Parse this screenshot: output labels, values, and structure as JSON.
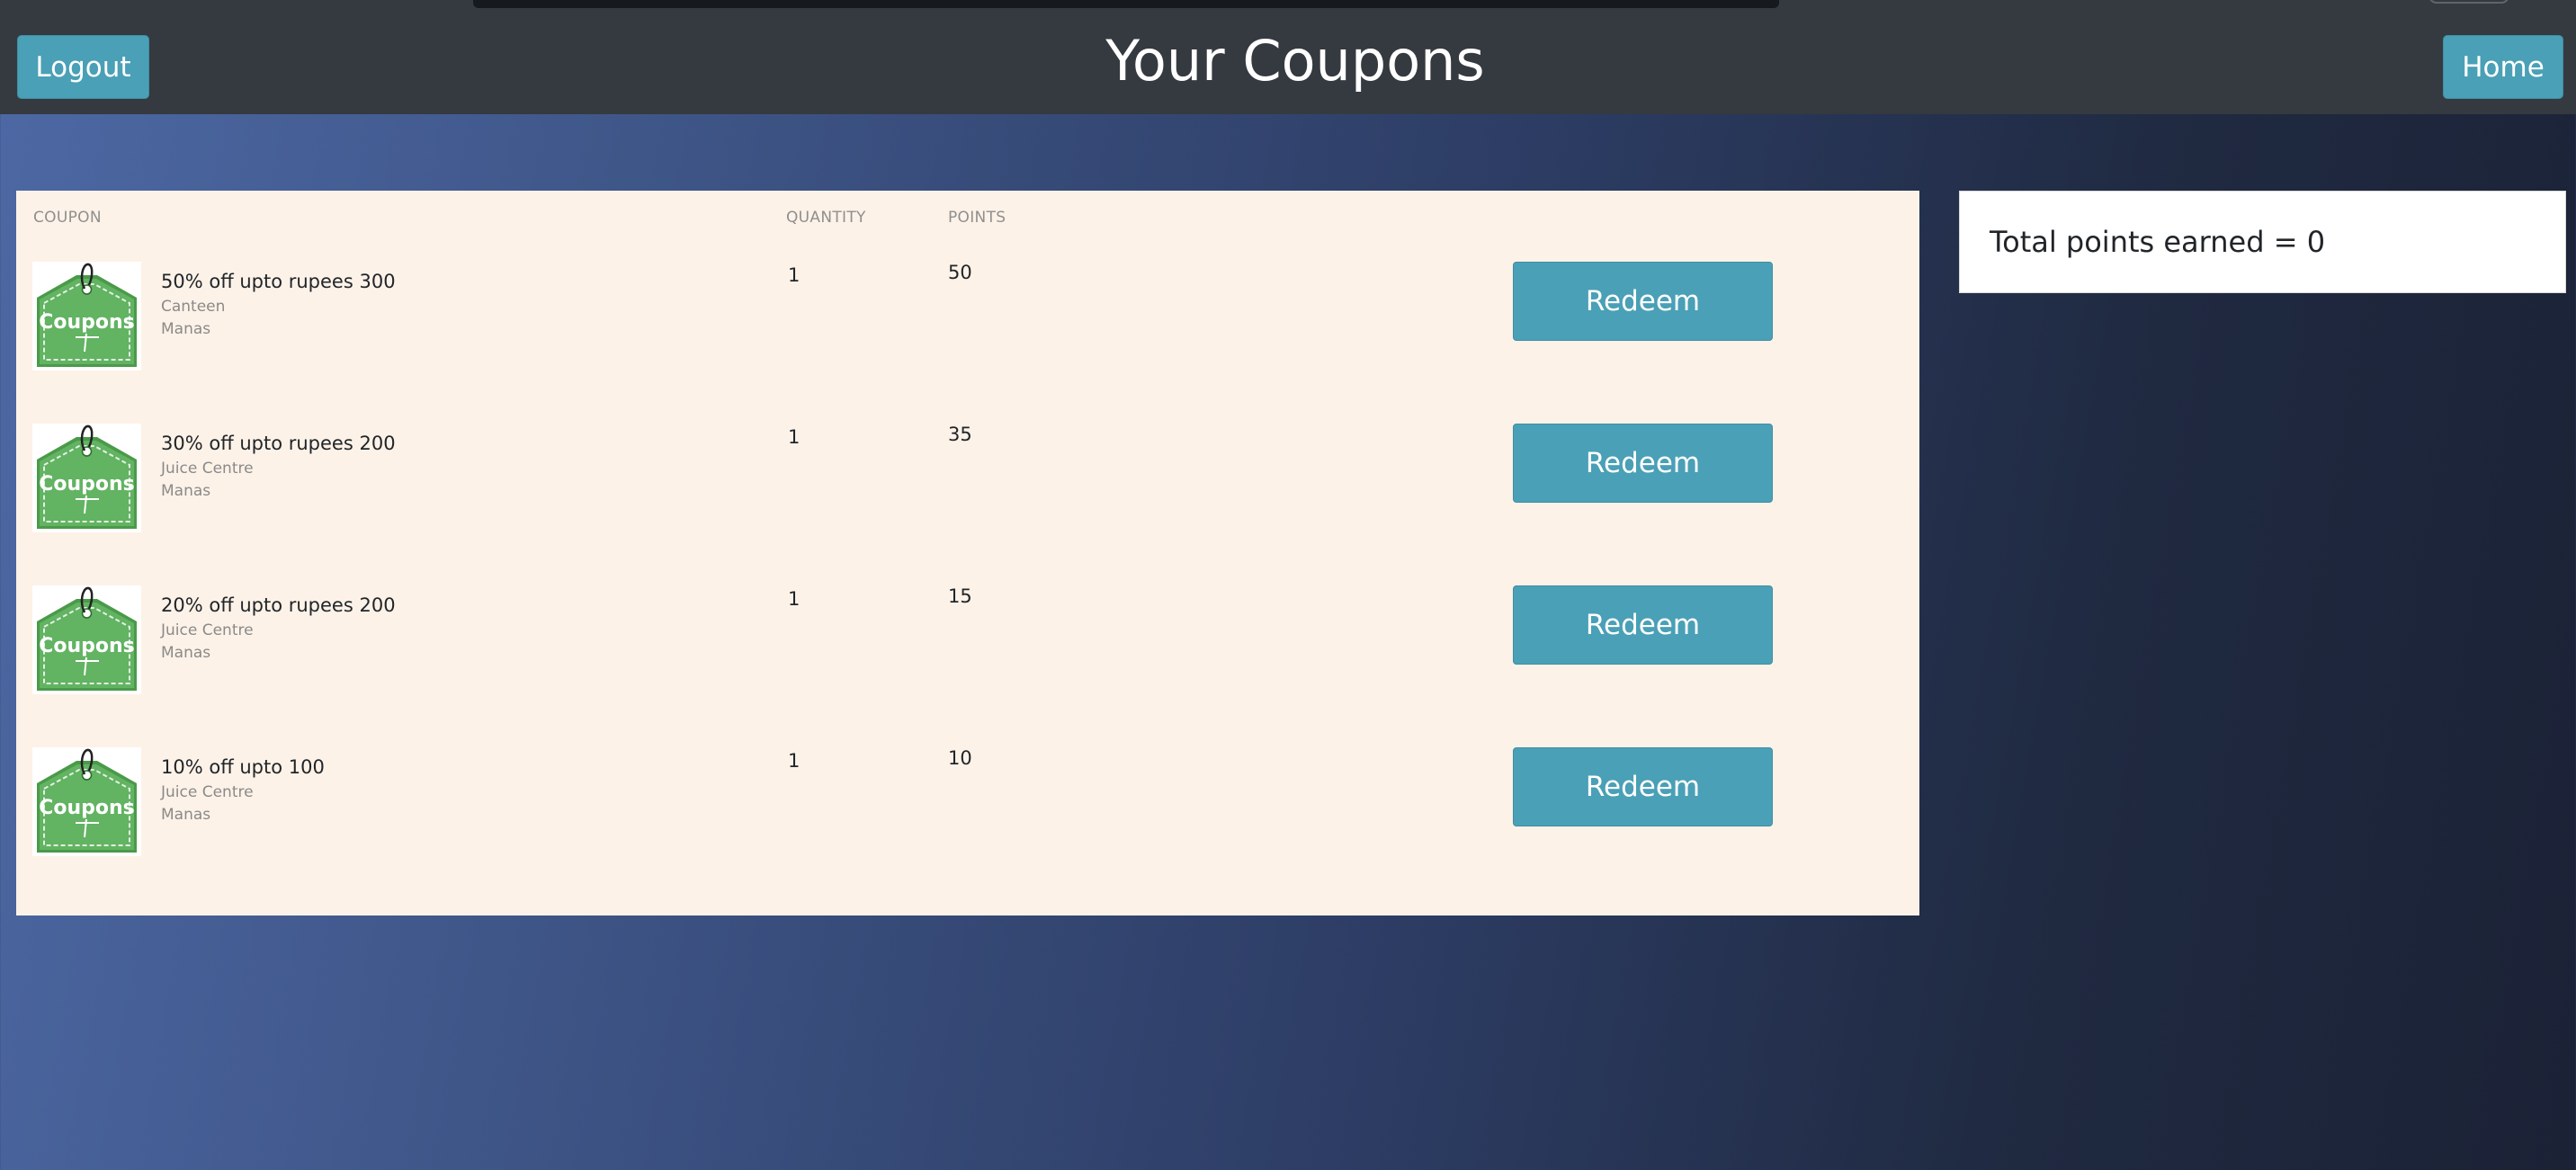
{
  "header": {
    "title": "Your Coupons",
    "logout_label": "Logout",
    "home_label": "Home"
  },
  "table": {
    "columns": [
      "COUPON",
      "QUANTITY",
      "POINTS"
    ],
    "rows": [
      {
        "title": "50% off upto rupees 300",
        "vendor": "Canteen",
        "location": "Manas",
        "quantity": "1",
        "points": "50",
        "action": "Redeem",
        "image_text": "Coupons"
      },
      {
        "title": "30% off upto rupees 200",
        "vendor": "Juice Centre",
        "location": "Manas",
        "quantity": "1",
        "points": "35",
        "action": "Redeem",
        "image_text": "Coupons"
      },
      {
        "title": "20% off upto rupees 200",
        "vendor": "Juice Centre",
        "location": "Manas",
        "quantity": "1",
        "points": "15",
        "action": "Redeem",
        "image_text": "Coupons"
      },
      {
        "title": "10% off upto 100",
        "vendor": "Juice Centre",
        "location": "Manas",
        "quantity": "1",
        "points": "10",
        "action": "Redeem",
        "image_text": "Coupons"
      }
    ]
  },
  "summary": {
    "total_points": "Total points earned = 0"
  },
  "colors": {
    "header_bg": "#353a40",
    "button": "#4aa0b6",
    "panel_bg": "#fdf2e8",
    "coupon_tag": "#5aaa5a"
  },
  "icons": {
    "coupon_image": "coupon-tag-icon"
  }
}
